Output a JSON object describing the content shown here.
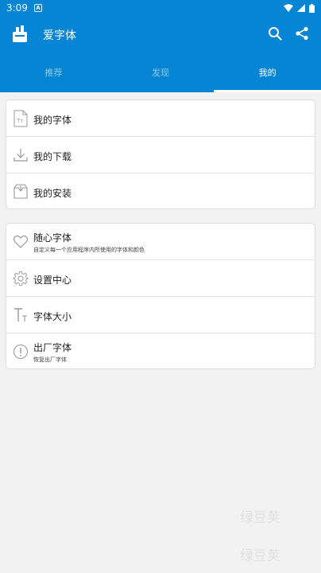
{
  "status_bar": {
    "time": "3:09",
    "notification": "A"
  },
  "app_bar": {
    "title": "爱字体"
  },
  "tabs": [
    {
      "label": "推荐",
      "active": false
    },
    {
      "label": "发现",
      "active": false
    },
    {
      "label": "我的",
      "active": true
    }
  ],
  "section1": [
    {
      "label": "我的字体",
      "icon": "font-file-icon"
    },
    {
      "label": "我的下载",
      "icon": "download-icon"
    },
    {
      "label": "我的安装",
      "icon": "install-box-icon"
    }
  ],
  "section2": [
    {
      "label": "随心字体",
      "sub": "自定义每一个应用程序内所使用的字体和颜色",
      "icon": "heart-icon"
    },
    {
      "label": "设置中心",
      "icon": "gear-icon"
    },
    {
      "label": "字体大小",
      "icon": "text-size-icon"
    },
    {
      "label": "出厂字体",
      "sub": "恢复出厂字体",
      "icon": "alert-icon"
    }
  ],
  "watermark": "绿豆荚",
  "colors": {
    "primary": "#0585d3",
    "background": "#f2f2f2"
  }
}
